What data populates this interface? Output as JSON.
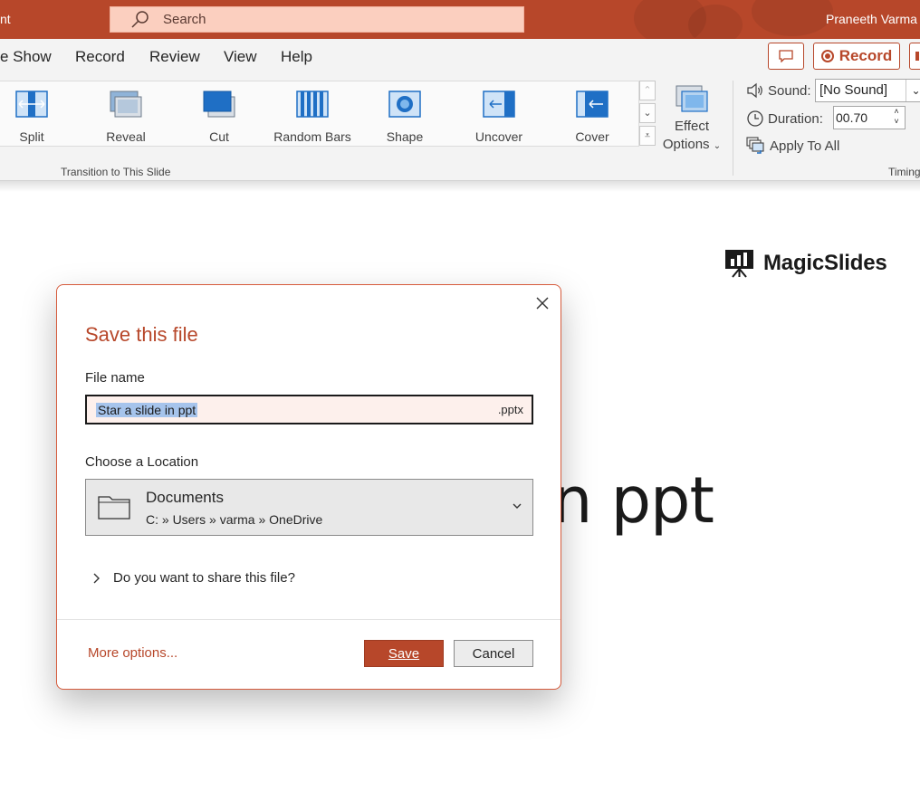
{
  "titlebar": {
    "app_title_fragment": "nt",
    "search_placeholder": "Search",
    "user_name": "Praneeth Varma"
  },
  "menu": {
    "items": [
      "e Show",
      "Record",
      "Review",
      "View",
      "Help"
    ],
    "record_button": "Record"
  },
  "ribbon": {
    "transitions": [
      {
        "label": "Split",
        "icon": "split-transition-icon"
      },
      {
        "label": "Reveal",
        "icon": "reveal-transition-icon"
      },
      {
        "label": "Cut",
        "icon": "cut-transition-icon"
      },
      {
        "label": "Random Bars",
        "icon": "random-bars-transition-icon"
      },
      {
        "label": "Shape",
        "icon": "shape-transition-icon"
      },
      {
        "label": "Uncover",
        "icon": "uncover-transition-icon"
      },
      {
        "label": "Cover",
        "icon": "cover-transition-icon"
      }
    ],
    "group_label": "Transition to This Slide",
    "effect_options_line1": "Effect",
    "effect_options_line2": "Options",
    "sound_label": "Sound:",
    "sound_value": "[No Sound]",
    "duration_label": "Duration:",
    "duration_value": "00.70",
    "apply_all": "Apply To All",
    "timing_group_label": "Timing"
  },
  "slide": {
    "brand_name": "MagicSlides",
    "title_fragment": "n ppt"
  },
  "dialog": {
    "title": "Save this file",
    "file_name_label": "File name",
    "file_name_value": "Star a slide in ppt",
    "file_extension": ".pptx",
    "location_label": "Choose a Location",
    "location_name": "Documents",
    "location_path": "C: » Users » varma » OneDrive",
    "share_question": "Do you want to share this file?",
    "more_options": "More options...",
    "save_button": "Save",
    "cancel_button": "Cancel"
  },
  "colors": {
    "accent": "#b7472a",
    "search_bg": "#fbcfbf",
    "selection": "#a6c4ec",
    "transition_blue": "#1f6fc5"
  }
}
